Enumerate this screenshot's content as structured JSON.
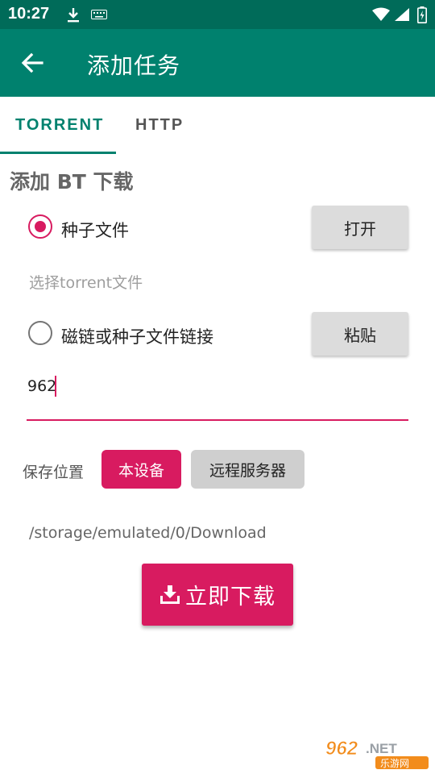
{
  "status_bar": {
    "time": "10:27",
    "icons": [
      "download-icon",
      "keyboard-icon",
      "wifi-icon",
      "signal-icon",
      "battery-icon"
    ]
  },
  "app_bar": {
    "title": "添加任务",
    "back_icon": "arrow-back-icon",
    "color": "#00816e"
  },
  "tabs": [
    {
      "label": "TORRENT",
      "selected": true
    },
    {
      "label": "HTTP",
      "selected": false
    }
  ],
  "section_title": "添加 BT 下载",
  "options": {
    "torrent_file": {
      "label": "种子文件",
      "checked": true,
      "button": "打开",
      "hint": "选择torrent文件"
    },
    "magnet": {
      "label": "磁链或种子文件链接",
      "checked": false,
      "button": "粘贴",
      "input_value": "962"
    }
  },
  "save_location": {
    "label": "保存位置",
    "chips": [
      {
        "label": "本设备",
        "selected": true
      },
      {
        "label": "远程服务器",
        "selected": false
      }
    ],
    "path": "/storage/emulated/0/Download"
  },
  "download_button": {
    "label": "立即下载",
    "icon": "download-icon"
  },
  "watermark": {
    "brand": "962.NET",
    "sub": "乐游网"
  },
  "colors": {
    "accent": "#d81b60",
    "primary": "#00816e",
    "status_bar": "#006b59"
  }
}
